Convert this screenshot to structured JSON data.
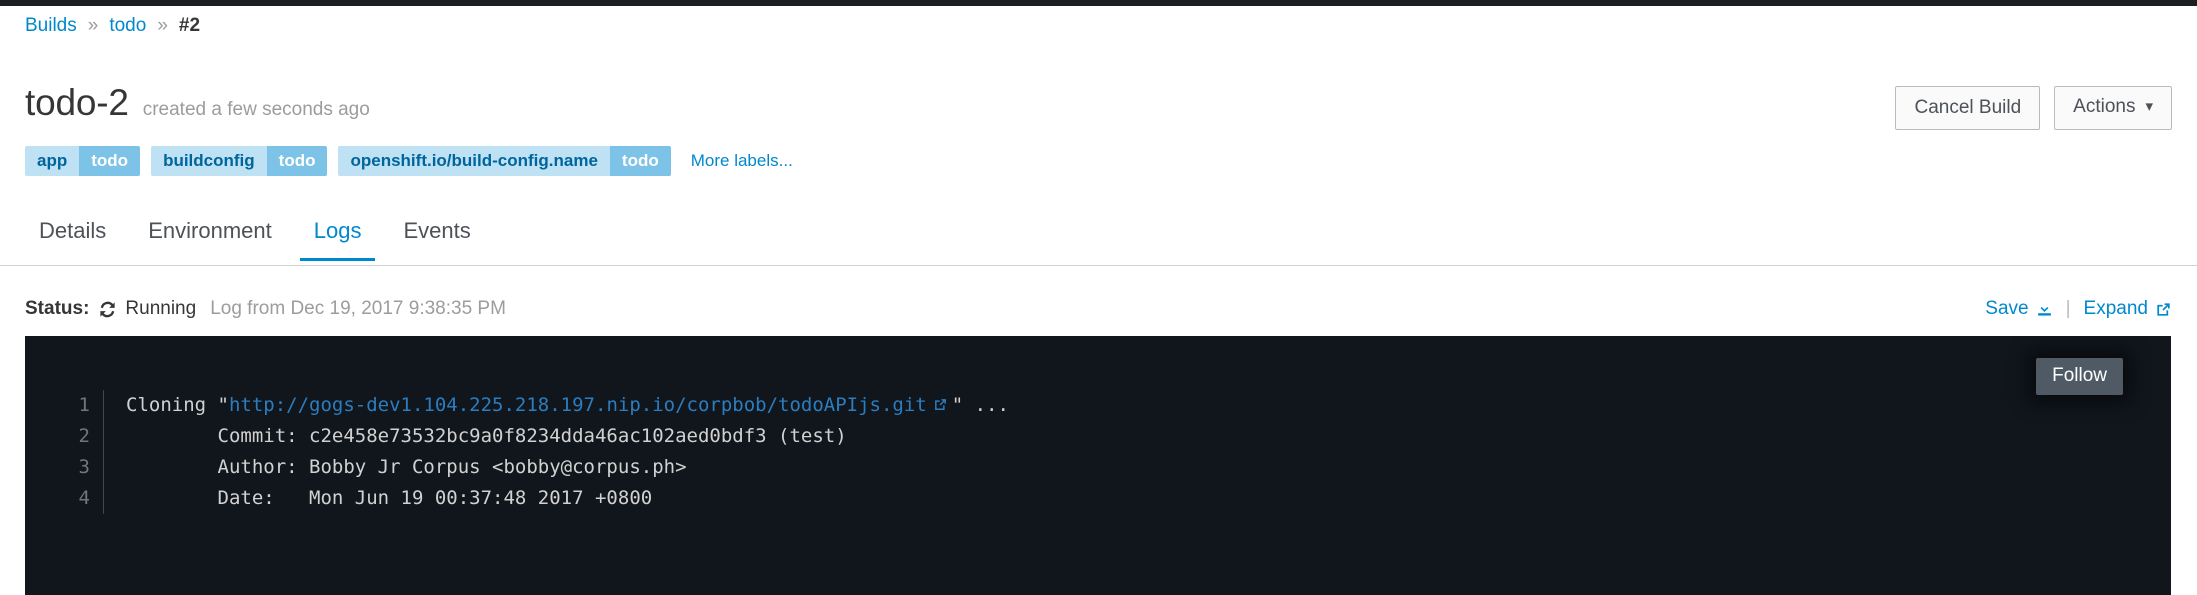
{
  "breadcrumb": {
    "items": [
      {
        "label": "Builds",
        "link": true
      },
      {
        "label": "todo",
        "link": true
      },
      {
        "label": "#2",
        "link": false
      }
    ],
    "separator": "»"
  },
  "header": {
    "title": "todo-2",
    "subtitle": "created a few seconds ago",
    "cancel_build_label": "Cancel Build",
    "actions_label": "Actions",
    "actions_caret": "⌄"
  },
  "labels": {
    "items": [
      {
        "key": "app",
        "value": "todo"
      },
      {
        "key": "buildconfig",
        "value": "todo"
      },
      {
        "key": "openshift.io/build-config.name",
        "value": "todo"
      }
    ],
    "more_label": "More labels...",
    "key_color": "#bee1f4",
    "value_color": "#7dc3e8"
  },
  "tabs": {
    "items": [
      {
        "label": "Details",
        "active": false
      },
      {
        "label": "Environment",
        "active": false
      },
      {
        "label": "Logs",
        "active": true
      },
      {
        "label": "Events",
        "active": false
      }
    ],
    "active_color": "#0088ce"
  },
  "status": {
    "label": "Status:",
    "icon": "spinner-icon",
    "icon_glyph": "↻",
    "value": "Running",
    "meta": "Log from Dec 19, 2017 9:38:35 PM"
  },
  "log_tools": {
    "save_label": "Save",
    "save_icon": "download-icon",
    "separator": "|",
    "expand_label": "Expand",
    "expand_icon": "external-link-icon"
  },
  "console": {
    "follow_label": "Follow",
    "background": "#11161c",
    "link_color": "#2b7dc0",
    "lines": [
      {
        "number": "1",
        "pre": "Cloning \"",
        "link": "http://gogs-dev1.104.225.218.197.nip.io/corpbob/todoAPIjs.git",
        "post": "\" ..."
      },
      {
        "number": "2",
        "pre": "        Commit: c2e458e73532bc9a0f8234dda46ac102aed0bdf3 (test)",
        "link": "",
        "post": ""
      },
      {
        "number": "3",
        "pre": "        Author: Bobby Jr Corpus <bobby@corpus.ph>",
        "link": "",
        "post": ""
      },
      {
        "number": "4",
        "pre": "        Date:   Mon Jun 19 00:37:48 2017 +0800",
        "link": "",
        "post": ""
      }
    ]
  }
}
